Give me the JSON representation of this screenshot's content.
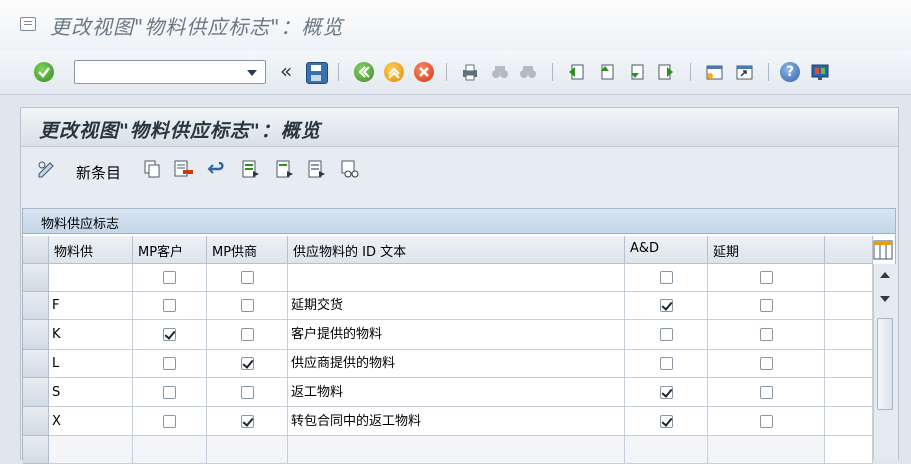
{
  "window": {
    "title": "更改视图\"物料供应标志\"：概览"
  },
  "toolbar": {
    "command_placeholder": "",
    "buttons": [
      "enter-icon",
      "save-icon",
      "back-icon",
      "exit-icon",
      "cancel-icon",
      "print-icon",
      "find-icon",
      "find-next-icon",
      "first-page-icon",
      "prev-page-icon",
      "next-page-icon",
      "last-page-icon",
      "create-session-icon",
      "shortcut-icon",
      "help-icon",
      "customize-layout-icon"
    ]
  },
  "page": {
    "title": "更改视图\"物料供应标志\"：概览"
  },
  "app_toolbar": {
    "new_entries": "新条目"
  },
  "table": {
    "caption": "物料供应标志",
    "columns": [
      "物料供",
      "MP客户",
      "MP供商",
      "供应物料的 ID 文本",
      "A&D",
      "延期"
    ],
    "rows": [
      {
        "key": "",
        "mp_customer": false,
        "mp_vendor": false,
        "text": "",
        "ad": false,
        "deferred": false
      },
      {
        "key": "F",
        "mp_customer": false,
        "mp_vendor": false,
        "text": "延期交货",
        "ad": true,
        "deferred": false
      },
      {
        "key": "K",
        "mp_customer": true,
        "mp_vendor": false,
        "text": "客户提供的物料",
        "ad": false,
        "deferred": false
      },
      {
        "key": "L",
        "mp_customer": false,
        "mp_vendor": true,
        "text": "供应商提供的物料",
        "ad": false,
        "deferred": false
      },
      {
        "key": "S",
        "mp_customer": false,
        "mp_vendor": false,
        "text": "返工物料",
        "ad": true,
        "deferred": false
      },
      {
        "key": "X",
        "mp_customer": false,
        "mp_vendor": true,
        "text": "转包合同中的返工物料",
        "ad": true,
        "deferred": false
      }
    ]
  }
}
